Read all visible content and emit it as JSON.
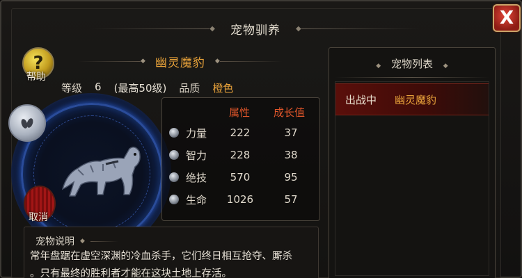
{
  "window": {
    "title": "宠物驯养",
    "close_label": "X"
  },
  "left": {
    "help_label": "帮助",
    "help_glyph": "?",
    "pet_name": "幽灵魔豹",
    "level_label": "等级",
    "level_value": "6",
    "max_level": "(最高50级)",
    "quality_label": "品质",
    "quality_value": "橙色",
    "cancel_label": "取消",
    "attributes": {
      "header_attr": "属性",
      "header_growth": "成长值",
      "rows": [
        {
          "name": "力量",
          "value": "222",
          "growth": "37"
        },
        {
          "name": "智力",
          "value": "228",
          "growth": "38"
        },
        {
          "name": "绝技",
          "value": "570",
          "growth": "95"
        },
        {
          "name": "生命",
          "value": "1026",
          "growth": "57"
        }
      ]
    },
    "description": {
      "title": "宠物说明",
      "line1": "常年盘踞在虚空深渊的冷血杀手，它们终日相互抢夺、厮杀",
      "line2": "。只有最终的胜利者才能在这块土地上存活。"
    }
  },
  "right": {
    "title": "宠物列表",
    "items": [
      {
        "status": "出战中",
        "pet": "幽灵魔豹"
      }
    ]
  },
  "colors": {
    "accent_orange": "#e8a23a",
    "header_red": "#e0562a",
    "selected_row": "#5a0f0a"
  }
}
